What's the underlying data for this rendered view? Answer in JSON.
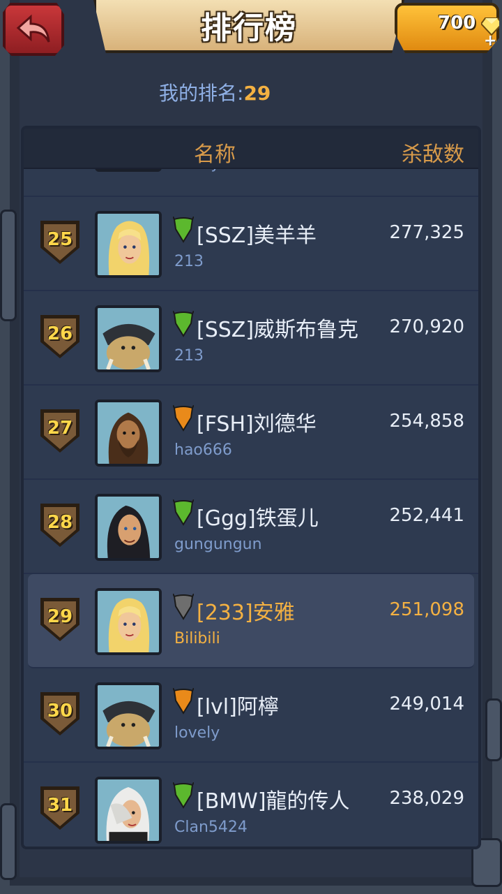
{
  "header": {
    "back_label": "",
    "title": "排行榜",
    "currency_value": "700"
  },
  "my_rank": {
    "label": "我的排名:",
    "value": "29"
  },
  "table": {
    "col_name": "名称",
    "col_kills": "杀敌数",
    "partial_top": {
      "clan": "lovely"
    },
    "rows": [
      {
        "rank": "25",
        "name": "[SSZ]美羊羊",
        "clan": "213",
        "kills": "277,325",
        "banner": "green",
        "hero": "blonde",
        "highlight": false
      },
      {
        "rank": "26",
        "name": "[SSZ]威斯布鲁克",
        "clan": "213",
        "kills": "270,920",
        "banner": "green",
        "hero": "brute",
        "highlight": false
      },
      {
        "rank": "27",
        "name": "[FSH]刘德华",
        "clan": "hao666",
        "kills": "254,858",
        "banner": "orange",
        "hero": "bearded",
        "highlight": false
      },
      {
        "rank": "28",
        "name": "[Ggg]铁蛋儿",
        "clan": "gungungun",
        "kills": "252,441",
        "banner": "green",
        "hero": "longhair",
        "highlight": false
      },
      {
        "rank": "29",
        "name": "[233]安雅",
        "clan": "Bilibili",
        "kills": "251,098",
        "banner": "gray",
        "hero": "blonde",
        "highlight": true
      },
      {
        "rank": "30",
        "name": "[lvl]阿檸",
        "clan": "lovely",
        "kills": "249,014",
        "banner": "orange",
        "hero": "brute",
        "highlight": false
      },
      {
        "rank": "31",
        "name": "[BMW]龍的传人",
        "clan": "Clan5424",
        "kills": "238,029",
        "banner": "green",
        "hero": "whitehair",
        "highlight": false
      }
    ]
  },
  "colors": {
    "accent": "#f4b142",
    "banner_green": "#5cb82e",
    "banner_orange": "#e98a1a",
    "banner_gray": "#6e6e6e"
  }
}
